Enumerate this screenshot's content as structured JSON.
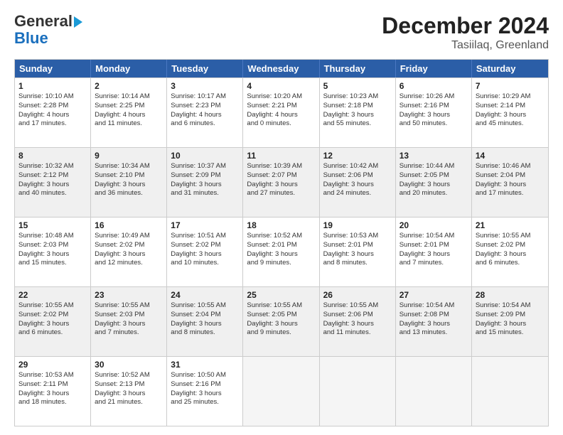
{
  "header": {
    "logo_line1": "General",
    "logo_line2": "Blue",
    "title": "December 2024",
    "subtitle": "Tasiilaq, Greenland"
  },
  "weekdays": [
    "Sunday",
    "Monday",
    "Tuesday",
    "Wednesday",
    "Thursday",
    "Friday",
    "Saturday"
  ],
  "rows": [
    [
      {
        "day": "1",
        "text": "Sunrise: 10:10 AM\nSunset: 2:28 PM\nDaylight: 4 hours\nand 17 minutes.",
        "shade": false
      },
      {
        "day": "2",
        "text": "Sunrise: 10:14 AM\nSunset: 2:25 PM\nDaylight: 4 hours\nand 11 minutes.",
        "shade": false
      },
      {
        "day": "3",
        "text": "Sunrise: 10:17 AM\nSunset: 2:23 PM\nDaylight: 4 hours\nand 6 minutes.",
        "shade": false
      },
      {
        "day": "4",
        "text": "Sunrise: 10:20 AM\nSunset: 2:21 PM\nDaylight: 4 hours\nand 0 minutes.",
        "shade": false
      },
      {
        "day": "5",
        "text": "Sunrise: 10:23 AM\nSunset: 2:18 PM\nDaylight: 3 hours\nand 55 minutes.",
        "shade": false
      },
      {
        "day": "6",
        "text": "Sunrise: 10:26 AM\nSunset: 2:16 PM\nDaylight: 3 hours\nand 50 minutes.",
        "shade": false
      },
      {
        "day": "7",
        "text": "Sunrise: 10:29 AM\nSunset: 2:14 PM\nDaylight: 3 hours\nand 45 minutes.",
        "shade": false
      }
    ],
    [
      {
        "day": "8",
        "text": "Sunrise: 10:32 AM\nSunset: 2:12 PM\nDaylight: 3 hours\nand 40 minutes.",
        "shade": true
      },
      {
        "day": "9",
        "text": "Sunrise: 10:34 AM\nSunset: 2:10 PM\nDaylight: 3 hours\nand 36 minutes.",
        "shade": true
      },
      {
        "day": "10",
        "text": "Sunrise: 10:37 AM\nSunset: 2:09 PM\nDaylight: 3 hours\nand 31 minutes.",
        "shade": true
      },
      {
        "day": "11",
        "text": "Sunrise: 10:39 AM\nSunset: 2:07 PM\nDaylight: 3 hours\nand 27 minutes.",
        "shade": true
      },
      {
        "day": "12",
        "text": "Sunrise: 10:42 AM\nSunset: 2:06 PM\nDaylight: 3 hours\nand 24 minutes.",
        "shade": true
      },
      {
        "day": "13",
        "text": "Sunrise: 10:44 AM\nSunset: 2:05 PM\nDaylight: 3 hours\nand 20 minutes.",
        "shade": true
      },
      {
        "day": "14",
        "text": "Sunrise: 10:46 AM\nSunset: 2:04 PM\nDaylight: 3 hours\nand 17 minutes.",
        "shade": true
      }
    ],
    [
      {
        "day": "15",
        "text": "Sunrise: 10:48 AM\nSunset: 2:03 PM\nDaylight: 3 hours\nand 15 minutes.",
        "shade": false
      },
      {
        "day": "16",
        "text": "Sunrise: 10:49 AM\nSunset: 2:02 PM\nDaylight: 3 hours\nand 12 minutes.",
        "shade": false
      },
      {
        "day": "17",
        "text": "Sunrise: 10:51 AM\nSunset: 2:02 PM\nDaylight: 3 hours\nand 10 minutes.",
        "shade": false
      },
      {
        "day": "18",
        "text": "Sunrise: 10:52 AM\nSunset: 2:01 PM\nDaylight: 3 hours\nand 9 minutes.",
        "shade": false
      },
      {
        "day": "19",
        "text": "Sunrise: 10:53 AM\nSunset: 2:01 PM\nDaylight: 3 hours\nand 8 minutes.",
        "shade": false
      },
      {
        "day": "20",
        "text": "Sunrise: 10:54 AM\nSunset: 2:01 PM\nDaylight: 3 hours\nand 7 minutes.",
        "shade": false
      },
      {
        "day": "21",
        "text": "Sunrise: 10:55 AM\nSunset: 2:02 PM\nDaylight: 3 hours\nand 6 minutes.",
        "shade": false
      }
    ],
    [
      {
        "day": "22",
        "text": "Sunrise: 10:55 AM\nSunset: 2:02 PM\nDaylight: 3 hours\nand 6 minutes.",
        "shade": true
      },
      {
        "day": "23",
        "text": "Sunrise: 10:55 AM\nSunset: 2:03 PM\nDaylight: 3 hours\nand 7 minutes.",
        "shade": true
      },
      {
        "day": "24",
        "text": "Sunrise: 10:55 AM\nSunset: 2:04 PM\nDaylight: 3 hours\nand 8 minutes.",
        "shade": true
      },
      {
        "day": "25",
        "text": "Sunrise: 10:55 AM\nSunset: 2:05 PM\nDaylight: 3 hours\nand 9 minutes.",
        "shade": true
      },
      {
        "day": "26",
        "text": "Sunrise: 10:55 AM\nSunset: 2:06 PM\nDaylight: 3 hours\nand 11 minutes.",
        "shade": true
      },
      {
        "day": "27",
        "text": "Sunrise: 10:54 AM\nSunset: 2:08 PM\nDaylight: 3 hours\nand 13 minutes.",
        "shade": true
      },
      {
        "day": "28",
        "text": "Sunrise: 10:54 AM\nSunset: 2:09 PM\nDaylight: 3 hours\nand 15 minutes.",
        "shade": true
      }
    ],
    [
      {
        "day": "29",
        "text": "Sunrise: 10:53 AM\nSunset: 2:11 PM\nDaylight: 3 hours\nand 18 minutes.",
        "shade": false
      },
      {
        "day": "30",
        "text": "Sunrise: 10:52 AM\nSunset: 2:13 PM\nDaylight: 3 hours\nand 21 minutes.",
        "shade": false
      },
      {
        "day": "31",
        "text": "Sunrise: 10:50 AM\nSunset: 2:16 PM\nDaylight: 3 hours\nand 25 minutes.",
        "shade": false
      },
      {
        "day": "",
        "text": "",
        "shade": false,
        "empty": true
      },
      {
        "day": "",
        "text": "",
        "shade": false,
        "empty": true
      },
      {
        "day": "",
        "text": "",
        "shade": false,
        "empty": true
      },
      {
        "day": "",
        "text": "",
        "shade": false,
        "empty": true
      }
    ]
  ]
}
